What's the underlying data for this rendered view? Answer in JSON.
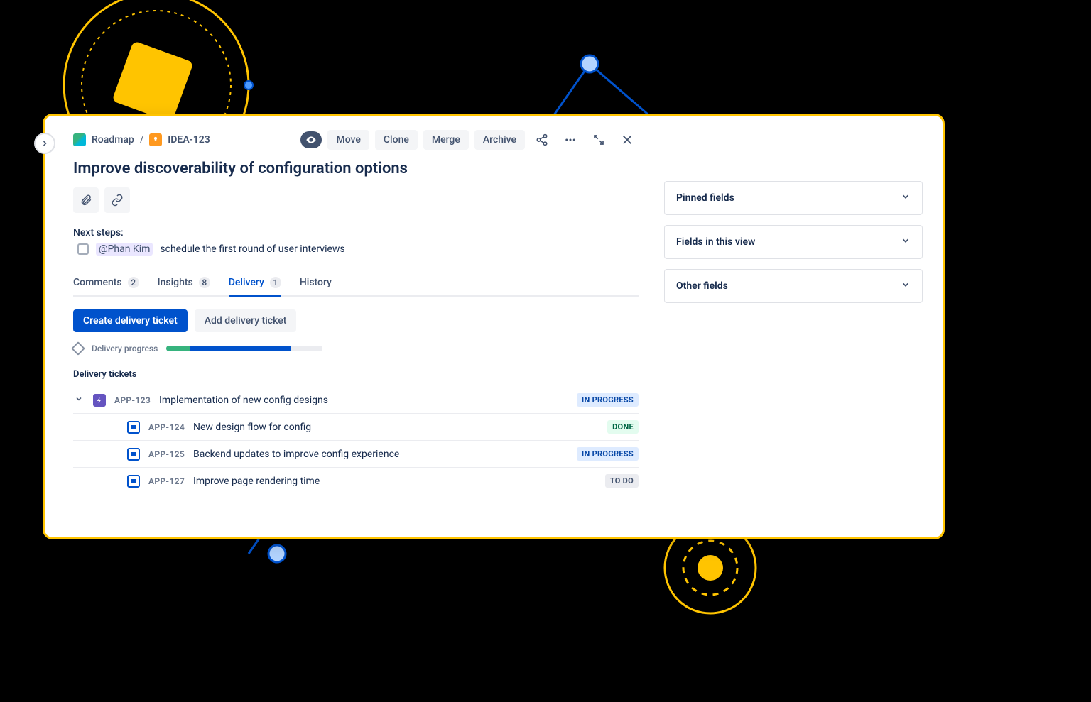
{
  "breadcrumb": {
    "project": "Roadmap",
    "idea_key": "IDEA-123"
  },
  "issue": {
    "title": "Improve discoverability of configuration options",
    "next_steps_label": "Next steps:",
    "mention": "@Phan Kim",
    "next_steps_text": "schedule the first round of user interviews"
  },
  "actions": {
    "move": "Move",
    "clone": "Clone",
    "merge": "Merge",
    "archive": "Archive"
  },
  "tabs": {
    "comments": {
      "label": "Comments",
      "count": "2"
    },
    "insights": {
      "label": "Insights",
      "count": "8"
    },
    "delivery": {
      "label": "Delivery",
      "count": "1"
    },
    "history": {
      "label": "History"
    }
  },
  "delivery": {
    "create_btn": "Create delivery ticket",
    "add_btn": "Add delivery ticket",
    "progress_label": "Delivery progress",
    "progress": {
      "done_pct": 15,
      "inprogress_pct": 65,
      "todo_pct": 20
    },
    "tickets_heading": "Delivery tickets",
    "tickets": [
      {
        "key": "APP-123",
        "type": "epic",
        "summary": "Implementation of new config designs",
        "status": "IN PROGRESS",
        "status_class": "inprogress",
        "indent": 0,
        "expandable": true
      },
      {
        "key": "APP-124",
        "type": "story",
        "summary": "New design flow for config",
        "status": "DONE",
        "status_class": "done",
        "indent": 1,
        "expandable": false
      },
      {
        "key": "APP-125",
        "type": "story",
        "summary": "Backend updates to improve config experience",
        "status": "IN PROGRESS",
        "status_class": "inprogress",
        "indent": 1,
        "expandable": false
      },
      {
        "key": "APP-127",
        "type": "story",
        "summary": "Improve page rendering time",
        "status": "TO DO",
        "status_class": "todo",
        "indent": 1,
        "expandable": false
      }
    ]
  },
  "side_panels": {
    "pinned": "Pinned fields",
    "view_fields": "Fields in this view",
    "other_fields": "Other fields"
  },
  "colors": {
    "brand_blue": "#0052CC",
    "green": "#36B37E",
    "yellow": "#FFC400"
  }
}
